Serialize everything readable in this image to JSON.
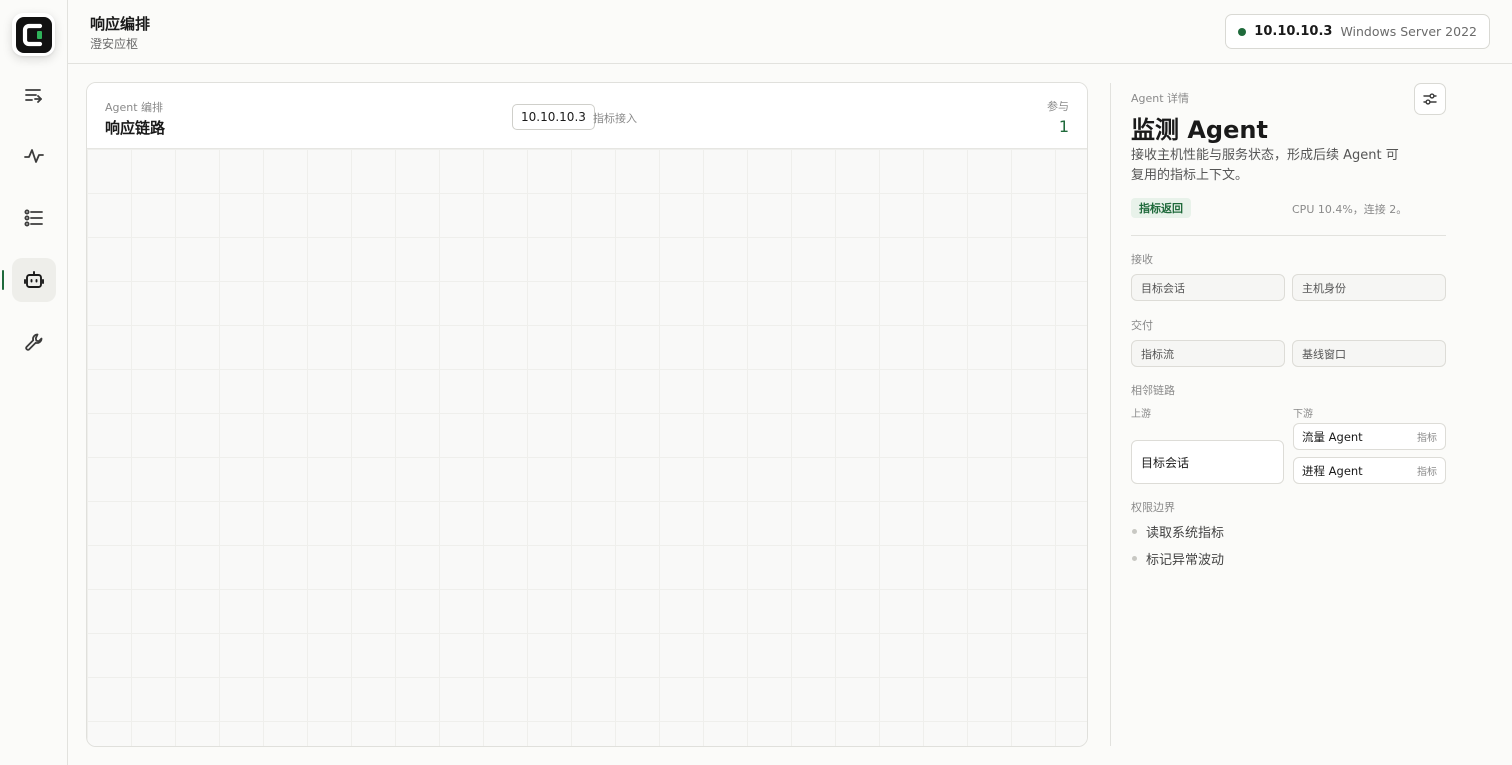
{
  "sidebar": {
    "logo_icon": "app-logo",
    "items": [
      {
        "name": "responses",
        "icon": "list-arrow-icon"
      },
      {
        "name": "activity",
        "icon": "pulse-icon"
      },
      {
        "name": "tasks",
        "icon": "checklist-icon"
      },
      {
        "name": "agents",
        "icon": "robot-icon",
        "active": true
      },
      {
        "name": "tools",
        "icon": "wrench-icon"
      }
    ]
  },
  "header": {
    "title": "响应编排",
    "subtitle": "澄安应枢",
    "host": {
      "ip": "10.10.10.3",
      "os": "Windows Server 2022",
      "status_color": "#1f6a3b"
    }
  },
  "canvas": {
    "eyebrow": "Agent 编排",
    "title": "响应链路",
    "ip_chip": "10.10.10.3",
    "ip_hint": "指标接入",
    "participants_label": "参与",
    "participants_count": "1"
  },
  "detail": {
    "eyebrow": "Agent 详情",
    "title": "监测 Agent",
    "description": "接收主机性能与服务状态，形成后续 Agent 可复用的指标上下文。",
    "badge": "指标返回",
    "metric_summary": "CPU 10.4%，连接 2。",
    "receive": {
      "label": "接收",
      "fields": [
        "目标会话",
        "主机身份"
      ]
    },
    "deliver": {
      "label": "交付",
      "fields": [
        "指标流",
        "基线窗口"
      ]
    },
    "neighbors": {
      "label": "相邻链路",
      "upstream_label": "上游",
      "downstream_label": "下游",
      "upstream": [
        "目标会话"
      ],
      "downstream": [
        {
          "name": "流量 Agent",
          "tag": "指标"
        },
        {
          "name": "进程 Agent",
          "tag": "指标"
        }
      ]
    },
    "permissions": {
      "label": "权限边界",
      "items": [
        "读取系统指标",
        "标记异常波动"
      ]
    }
  },
  "colors": {
    "accent": "#1f6a3b",
    "badge_bg": "#e8f2ea"
  }
}
